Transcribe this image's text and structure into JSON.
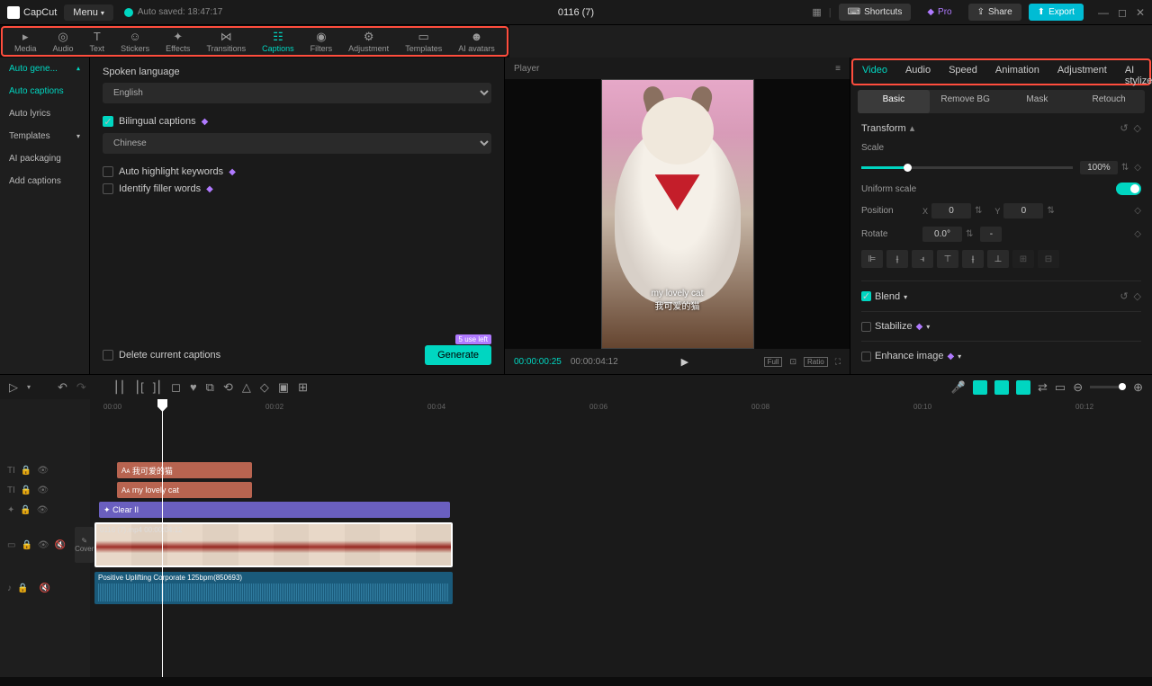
{
  "topbar": {
    "logo": "CapCut",
    "menu": "Menu",
    "autosave": "Auto saved: 18:47:17",
    "title": "0116 (7)",
    "shortcuts": "Shortcuts",
    "pro": "Pro",
    "share": "Share",
    "export": "Export"
  },
  "tools": [
    {
      "label": "Media"
    },
    {
      "label": "Audio"
    },
    {
      "label": "Text"
    },
    {
      "label": "Stickers"
    },
    {
      "label": "Effects"
    },
    {
      "label": "Transitions"
    },
    {
      "label": "Captions"
    },
    {
      "label": "Filters"
    },
    {
      "label": "Adjustment"
    },
    {
      "label": "Templates"
    },
    {
      "label": "AI avatars"
    }
  ],
  "sidebar": {
    "items": [
      "Auto gene...",
      "Auto captions",
      "Auto lyrics",
      "Templates",
      "AI packaging",
      "Add captions"
    ]
  },
  "captions_panel": {
    "spoken_label": "Spoken language",
    "spoken_value": "English",
    "bilingual": "Bilingual captions",
    "bilingual_lang": "Chinese",
    "highlight": "Auto highlight keywords",
    "filler": "Identify filler words",
    "delete": "Delete current captions",
    "uses_left": "5 use left",
    "generate": "Generate"
  },
  "player": {
    "label": "Player",
    "caption_en": "my lovely cat",
    "caption_cn": "我可爱的猫",
    "time_current": "00:00:00:25",
    "time_total": "00:00:04:12",
    "full": "Full",
    "ratio": "Ratio"
  },
  "right_tabs": [
    "Video",
    "Audio",
    "Speed",
    "Animation",
    "Adjustment",
    "AI stylize"
  ],
  "right_subtabs": [
    "Basic",
    "Remove BG",
    "Mask",
    "Retouch"
  ],
  "inspector": {
    "transform": "Transform",
    "scale_label": "Scale",
    "scale_value": "100%",
    "uniform": "Uniform scale",
    "position": "Position",
    "pos_x": "0",
    "pos_y": "0",
    "rotate": "Rotate",
    "rotate_value": "0.0°",
    "blend": "Blend",
    "stabilize": "Stabilize",
    "enhance": "Enhance image"
  },
  "timeline": {
    "ruler": [
      "00:00",
      "00:02",
      "00:04",
      "00:06",
      "00:08",
      "00:10",
      "00:12"
    ],
    "cover": "Cover",
    "caption_cn_clip": "我可爱的猫",
    "caption_en_clip": "my lovely cat",
    "effect_clip": "Clear II",
    "video_clip": "0116 (7).mp4   00:00:04:12",
    "audio_clip": "Positive Uplifting Corporate 125bpm(850693)"
  }
}
